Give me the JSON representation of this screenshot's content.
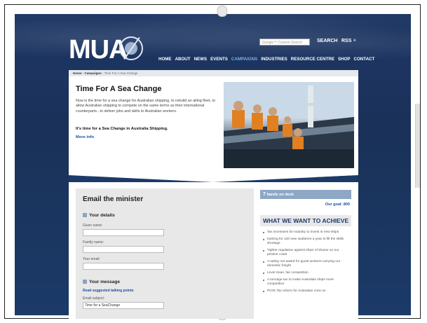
{
  "header": {
    "logo_text": "MUA",
    "search_placeholder": "Google™ Custom Search",
    "search_label": "SEARCH",
    "rss_label": "RSS"
  },
  "nav": {
    "items": [
      "HOME",
      "ABOUT",
      "NEWS",
      "EVENTS",
      "CAMPAIGNS",
      "INDUSTRIES",
      "RESOURCE CENTRE",
      "SHOP",
      "CONTACT"
    ],
    "active": "CAMPAIGNS"
  },
  "breadcrumb": [
    "Home",
    "Campaigns",
    "Time For A Sea Change"
  ],
  "hero": {
    "title": "Time For A Sea Change",
    "body": "Now is the time for a sea change for Australian shipping, to rebuild an ailing fleet, to allow Australian shipping to compete on the same terms as their international counterparts...to deliver jobs and skills to Australian workers.",
    "strong": "It's time for a Sea Change in Australia Shipping.",
    "more": "More info"
  },
  "form": {
    "title": "Email the minister",
    "details_heading": "Your details",
    "given_label": "Given name:",
    "family_label": "Family name:",
    "email_label": "Your email:",
    "message_heading": "Your message",
    "talking_points": "Read suggested talking points",
    "subject_label": "Email subject:",
    "subject_value": "Time for a SeaChange"
  },
  "side": {
    "hands_count": "7",
    "hands_label": "hands on deck",
    "goal": "Our goal: 800",
    "what_heading": "WHAT WE WANT TO ACHIEVE",
    "bullets": [
      "Tax incentives for industry to invest in new ships",
      "training for 120 new seafarers a year to fill the skills shortage",
      "Tighter regulation against ships of shame on our pristine coast",
      "A safety net award for guest workers carrying our domestic freight",
      "Level Seas, fair competition",
      "A tonnage tax to make Australian ships more competitive",
      "PAYE Tax reform for Australian crew on"
    ]
  },
  "colors": {
    "sea": "#1b3a68",
    "link": "#1b4f9b",
    "nav_active": "#7fb1e8",
    "panel": "#e8e8e8",
    "hands_bar": "#8ea7c5"
  },
  "icons": [
    "rss-icon",
    "logo-emblem-icon",
    "section-square-icon"
  ]
}
